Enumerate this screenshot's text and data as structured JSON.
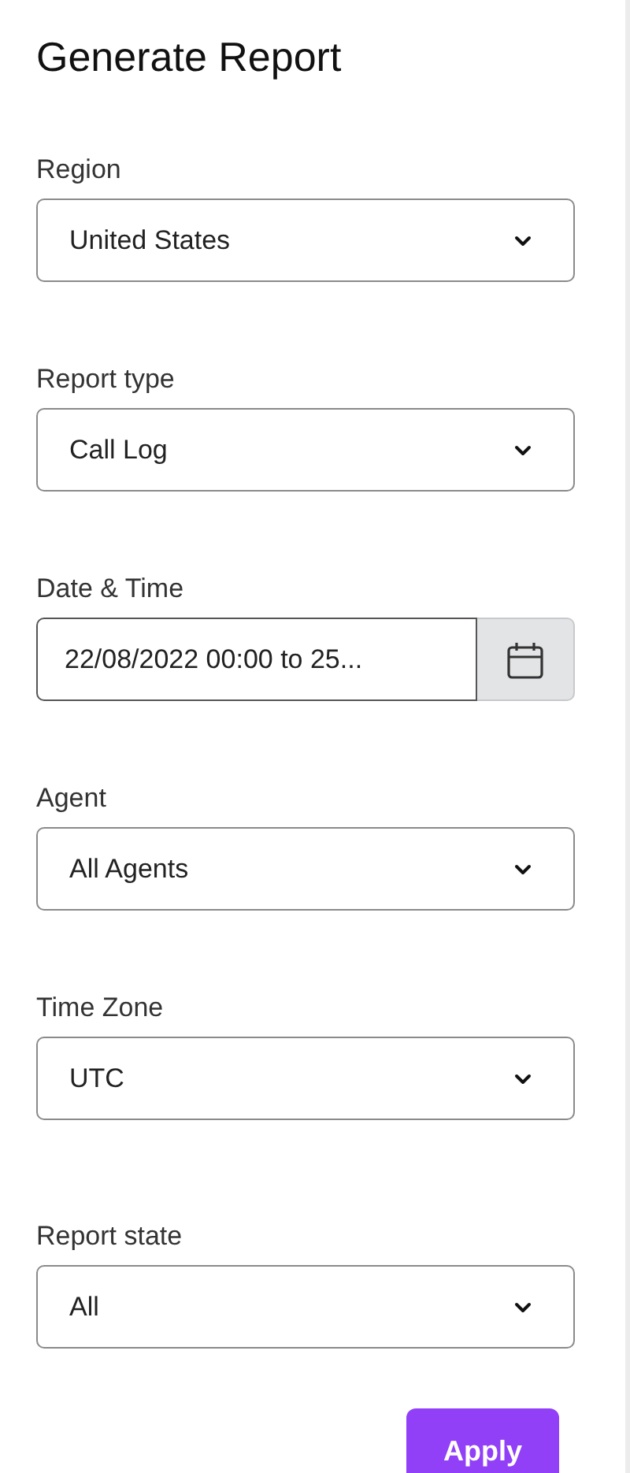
{
  "title": "Generate Report",
  "fields": [
    {
      "kind": "select",
      "label": "Region",
      "value": "United States"
    },
    {
      "kind": "select",
      "label": "Report type",
      "value": "Call Log"
    },
    {
      "kind": "daterange",
      "label": "Date & Time",
      "value": "22/08/2022 00:00 to 25..."
    },
    {
      "kind": "select",
      "label": "Agent",
      "value": "All Agents"
    },
    {
      "kind": "select",
      "label": "Time Zone",
      "value": "UTC"
    },
    {
      "kind": "select",
      "label": "Report state",
      "value": "All"
    }
  ],
  "apply_button": "Apply"
}
